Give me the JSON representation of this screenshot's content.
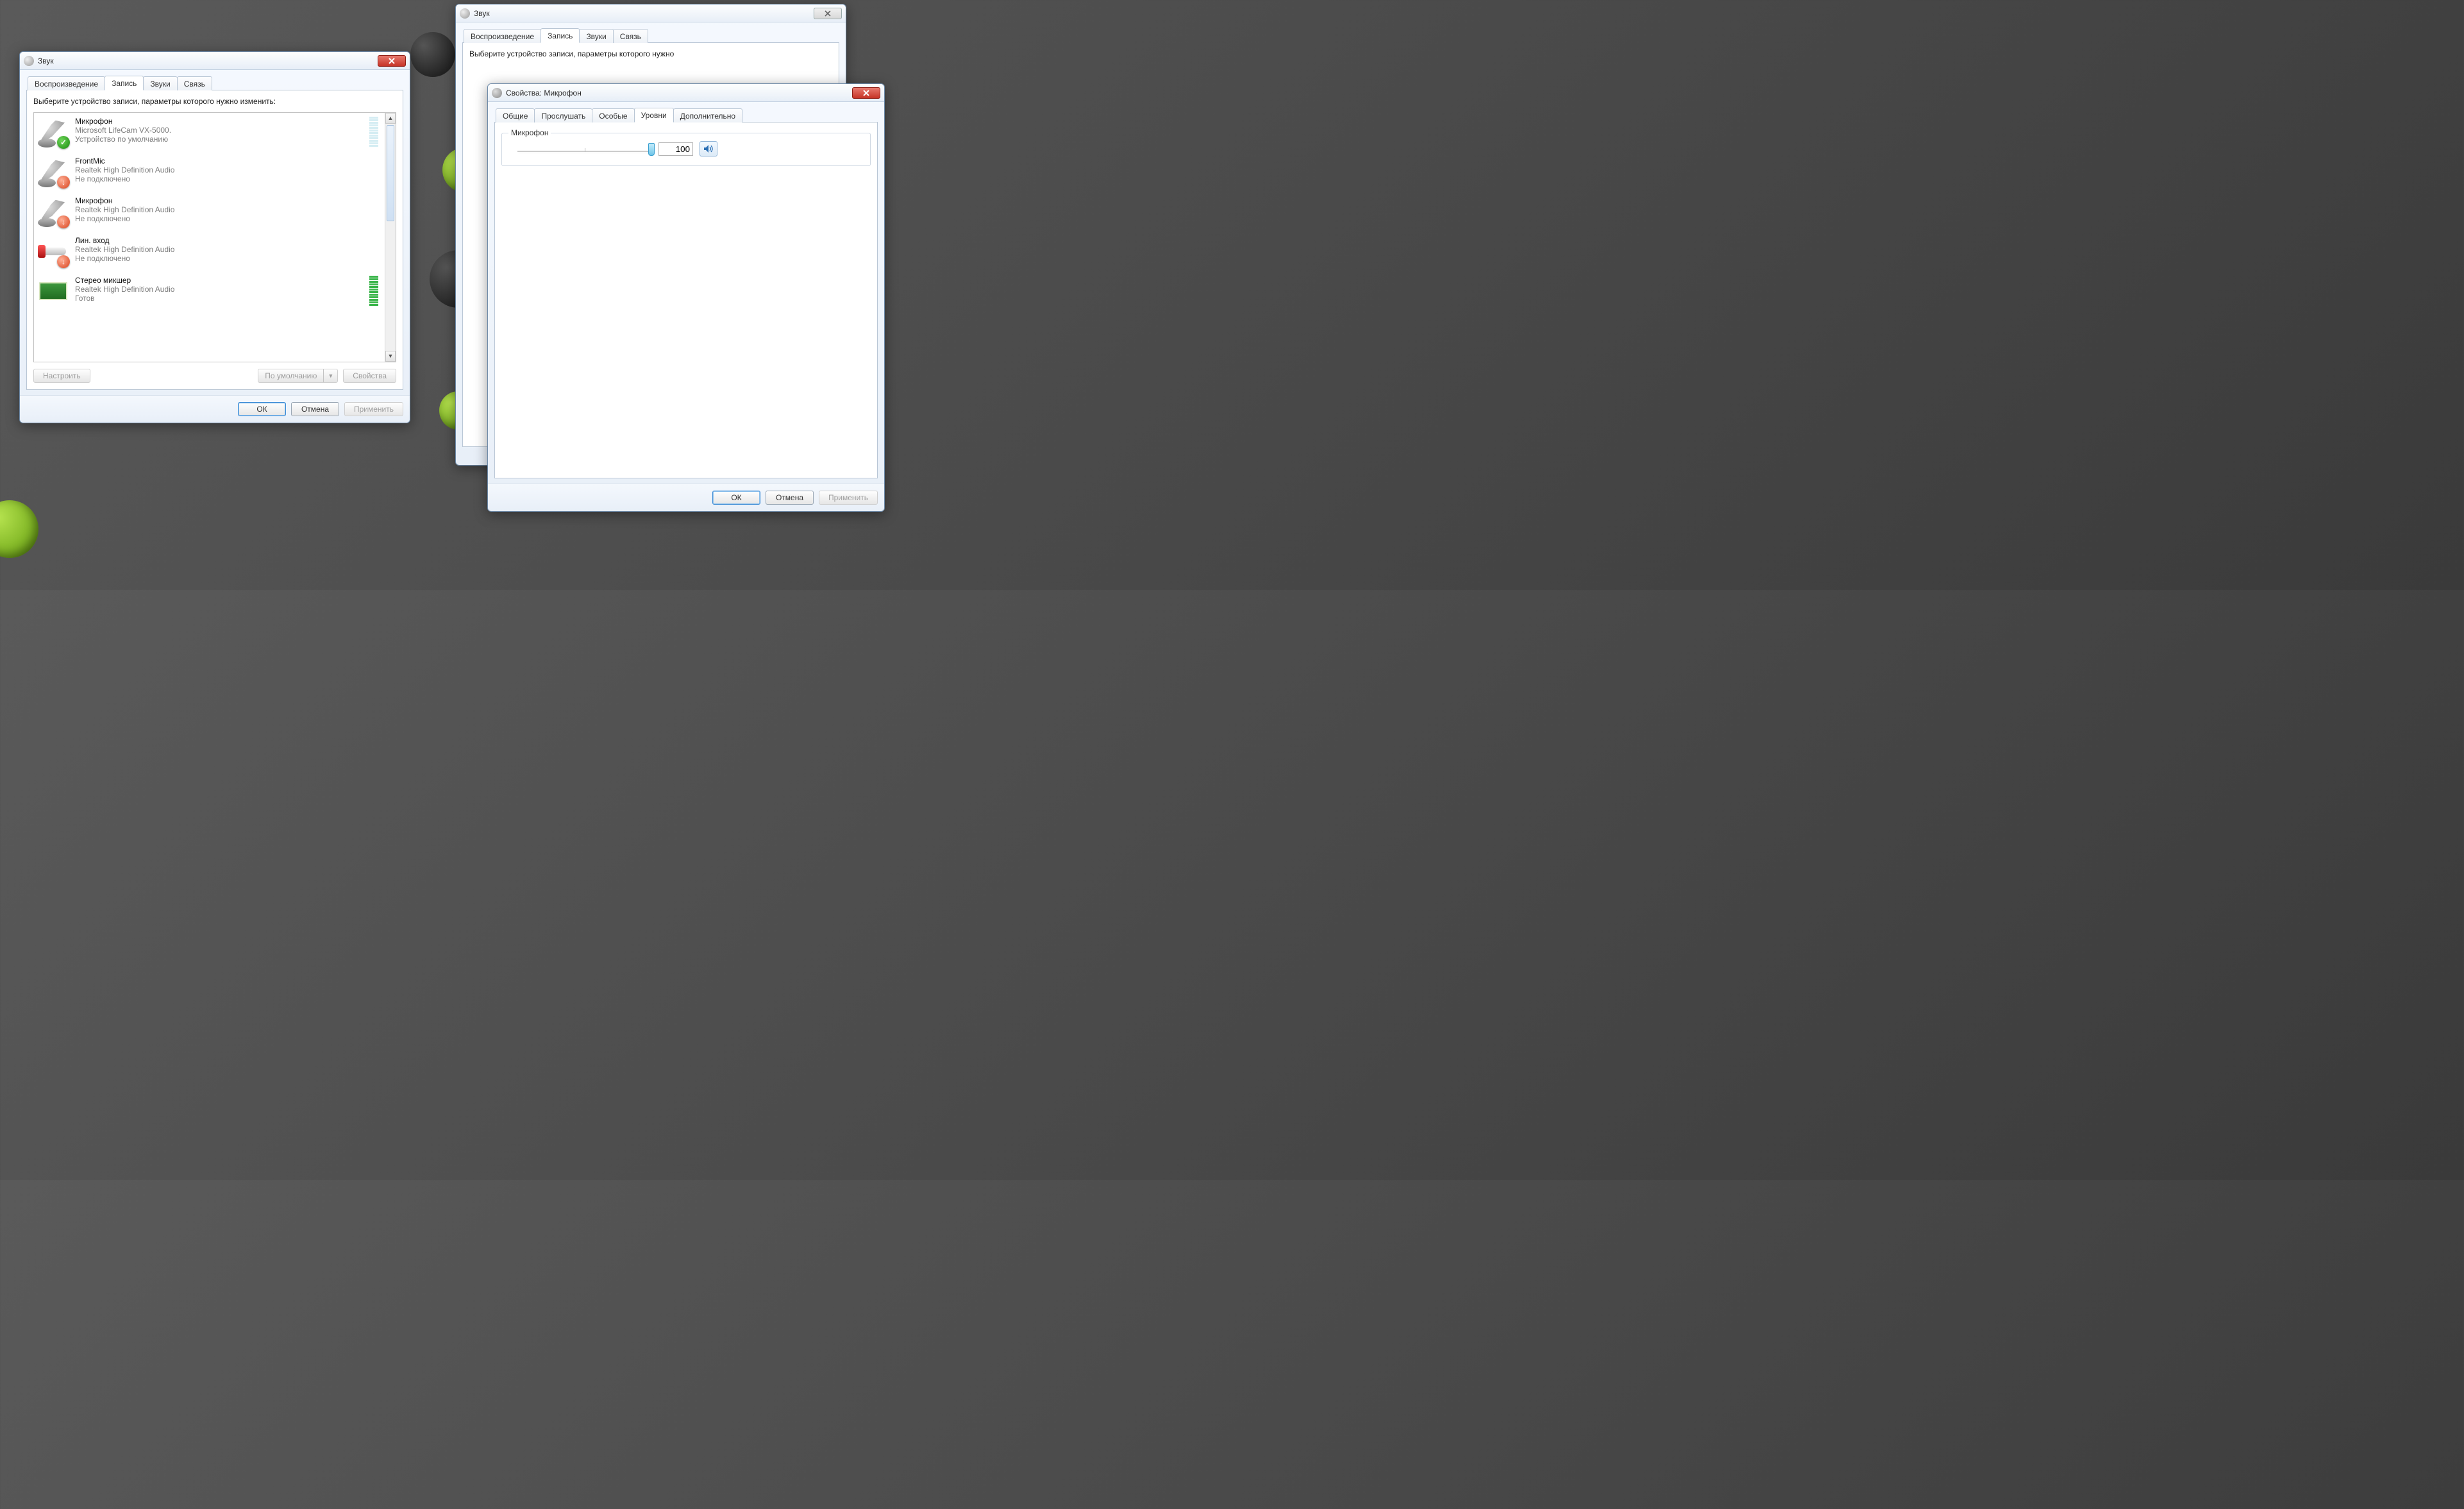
{
  "wallpaper": {
    "note": "blurred green/dark spheres"
  },
  "left_window": {
    "title": "Звук",
    "tabs": [
      "Воспроизведение",
      "Запись",
      "Звуки",
      "Связь"
    ],
    "active_tab_index": 1,
    "instructions": "Выберите устройство записи, параметры которого нужно изменить:",
    "devices": [
      {
        "name": "Микрофон",
        "desc": "Microsoft LifeCam VX-5000.",
        "status": "Устройство по умолчанию",
        "icon": "mic",
        "badge": "ok",
        "meter": "faint"
      },
      {
        "name": "FrontMic",
        "desc": "Realtek High Definition Audio",
        "status": "Не подключено",
        "icon": "mic",
        "badge": "down",
        "meter": "none"
      },
      {
        "name": "Микрофон",
        "desc": "Realtek High Definition Audio",
        "status": "Не подключено",
        "icon": "mic",
        "badge": "down",
        "meter": "none"
      },
      {
        "name": "Лин. вход",
        "desc": "Realtek High Definition Audio",
        "status": "Не подключено",
        "icon": "linein",
        "badge": "down",
        "meter": "none"
      },
      {
        "name": "Стерео микшер",
        "desc": "Realtek High Definition Audio",
        "status": "Готов",
        "icon": "card",
        "badge": "none",
        "meter": "active"
      }
    ],
    "buttons": {
      "configure": "Настроить",
      "set_default": "По умолчанию",
      "properties": "Свойства"
    },
    "footer": {
      "ok": "ОК",
      "cancel": "Отмена",
      "apply": "Применить"
    }
  },
  "right_bg_window": {
    "title": "Звук",
    "tabs": [
      "Воспроизведение",
      "Запись",
      "Звуки",
      "Связь"
    ],
    "active_tab_index": 1,
    "instructions_partial": "Выберите устройство записи, параметры которого нужно"
  },
  "props_window": {
    "title": "Свойства: Микрофон",
    "tabs": [
      "Общие",
      "Прослушать",
      "Особые",
      "Уровни",
      "Дополнительно"
    ],
    "active_tab_index": 3,
    "group_label": "Микрофон",
    "level_value": "100",
    "footer": {
      "ok": "ОК",
      "cancel": "Отмена",
      "apply": "Применить"
    }
  }
}
